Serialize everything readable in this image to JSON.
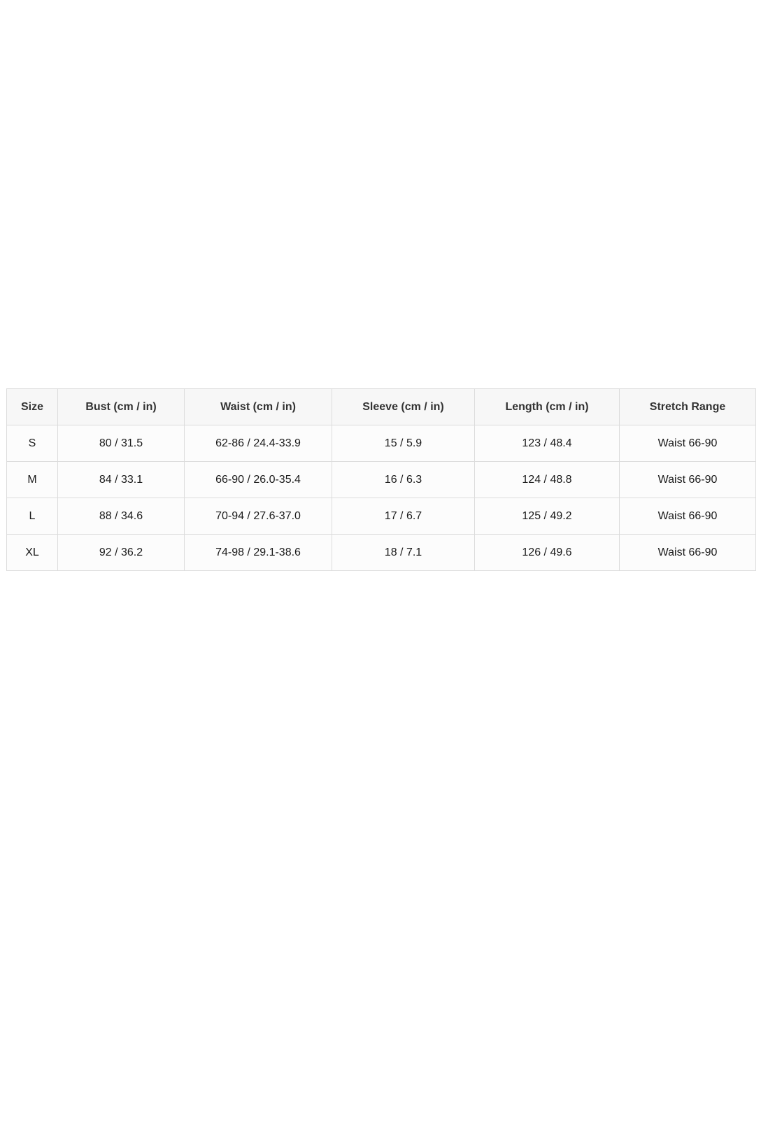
{
  "size_chart": {
    "headers": [
      "Size",
      "Bust (cm / in)",
      "Waist (cm / in)",
      "Sleeve (cm / in)",
      "Length (cm / in)",
      "Stretch Range"
    ],
    "rows": [
      [
        "S",
        "80 / 31.5",
        "62-86 / 24.4-33.9",
        "15 / 5.9",
        "123 / 48.4",
        "Waist 66-90"
      ],
      [
        "M",
        "84 / 33.1",
        "66-90 / 26.0-35.4",
        "16 / 6.3",
        "124 / 48.8",
        "Waist 66-90"
      ],
      [
        "L",
        "88 / 34.6",
        "70-94 / 27.6-37.0",
        "17 / 6.7",
        "125 / 49.2",
        "Waist 66-90"
      ],
      [
        "XL",
        "92 / 36.2",
        "74-98 / 29.1-38.6",
        "18 / 7.1",
        "126 / 49.6",
        "Waist 66-90"
      ]
    ]
  }
}
